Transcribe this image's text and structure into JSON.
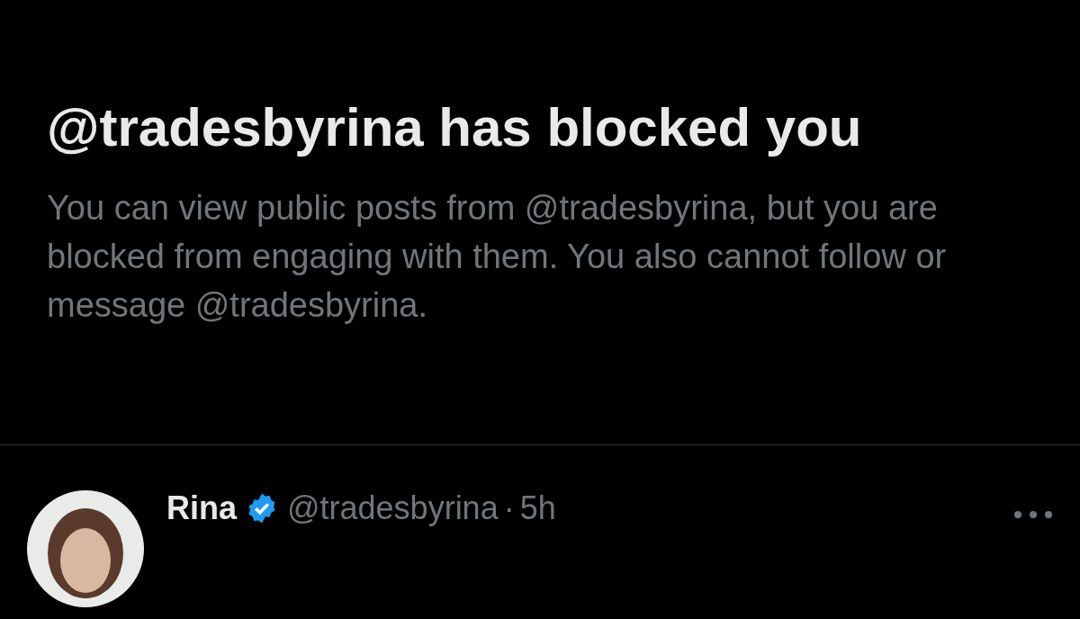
{
  "notice": {
    "title": "@tradesbyrina has blocked you",
    "message": "You can view public posts from @tradesbyrina, but you are blocked from engaging with them. You also cannot follow or message @tradesbyrina."
  },
  "post": {
    "name": "Rina",
    "verified": true,
    "handle": "@tradesbyrina",
    "separator": "·",
    "time": "5h"
  }
}
